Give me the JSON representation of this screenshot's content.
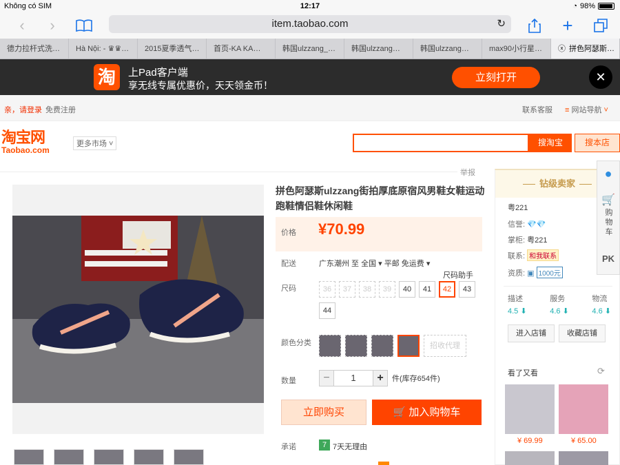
{
  "status_bar": {
    "carrier": "Không có SIM",
    "time": "12:17",
    "battery": "98%"
  },
  "browser": {
    "url": "item.taobao.com",
    "tabs": [
      "德力拉杆式洗…",
      "Hà Nội: - ♛♛…",
      "2015夏季透气…",
      "首页-KA KA…",
      "韩国ulzzang_…",
      "韩国ulzzang…",
      "韩国ulzzang…",
      "max90小行星…",
      "拼色阿瑟斯…"
    ]
  },
  "app_banner": {
    "logo": "淘",
    "title": "上Pad客户端",
    "subtitle": "享无线专属优惠价，天天领金币！",
    "open_label": "立刻打开",
    "close_label": "✕"
  },
  "site_nav": {
    "login": "亲，请登录",
    "register": "免费注册",
    "customer_service": "联系客服",
    "site_navigation": "网站导航"
  },
  "header": {
    "logo_cn": "淘宝网",
    "logo_en": "Taobao.com",
    "more_market": "更多市场",
    "search_taobao": "搜淘宝",
    "search_store": "搜本店"
  },
  "product": {
    "report": "举报",
    "title": "拼色阿瑟斯ulzzang街拍厚底原宿风男鞋女鞋运动跑鞋情侣鞋休闲鞋",
    "price_label": "价格",
    "price": "¥70.99",
    "shipping_label": "配送",
    "shipping": "广东潮州 至  全国 ▾     平邮 免运费 ▾",
    "size_helper": "尺码助手",
    "size_label": "尺码",
    "sizes": [
      {
        "value": "36",
        "state": "disabled"
      },
      {
        "value": "37",
        "state": "disabled"
      },
      {
        "value": "38",
        "state": "disabled"
      },
      {
        "value": "39",
        "state": "disabled"
      },
      {
        "value": "40",
        "state": "normal"
      },
      {
        "value": "41",
        "state": "normal"
      },
      {
        "value": "42",
        "state": "selected"
      },
      {
        "value": "43",
        "state": "normal"
      },
      {
        "value": "44",
        "state": "normal"
      }
    ],
    "color_label": "颜色分类",
    "color_agent": "招收代理",
    "qty_label": "数量",
    "qty_minus": "−",
    "qty_value": "1",
    "qty_plus": "+",
    "stock": "件(库存654件)",
    "buy_now": "立即购买",
    "add_cart": "加入购物车",
    "promise_label": "承诺",
    "promise_icon": "7",
    "promise_text": "7天无理由"
  },
  "seller": {
    "level": "钻级卖家",
    "name": "粤221",
    "credit_label": "信誉:",
    "credit_value": "💎💎",
    "owner_label": "掌柜:",
    "owner_value": "粤221",
    "contact_label": "联系:",
    "contact_value": "和我联系",
    "qual_label": "资质:",
    "qual_value": "1000元",
    "scores": [
      {
        "label": "描述",
        "value": "4.5 ⬇"
      },
      {
        "label": "服务",
        "value": "4.6 ⬇"
      },
      {
        "label": "物流",
        "value": "4.6 ⬇"
      }
    ],
    "enter_store": "进入店铺",
    "fav_store": "收藏店铺",
    "seen_title": "看了又看",
    "rec_prices": [
      "¥ 69.99",
      "¥ 65.00"
    ]
  },
  "floatbar": {
    "cart": "购物车",
    "pk": "PK"
  },
  "colors": {
    "accent": "#ff5000",
    "price": "#ff4400",
    "gold": "#c69b4d"
  }
}
